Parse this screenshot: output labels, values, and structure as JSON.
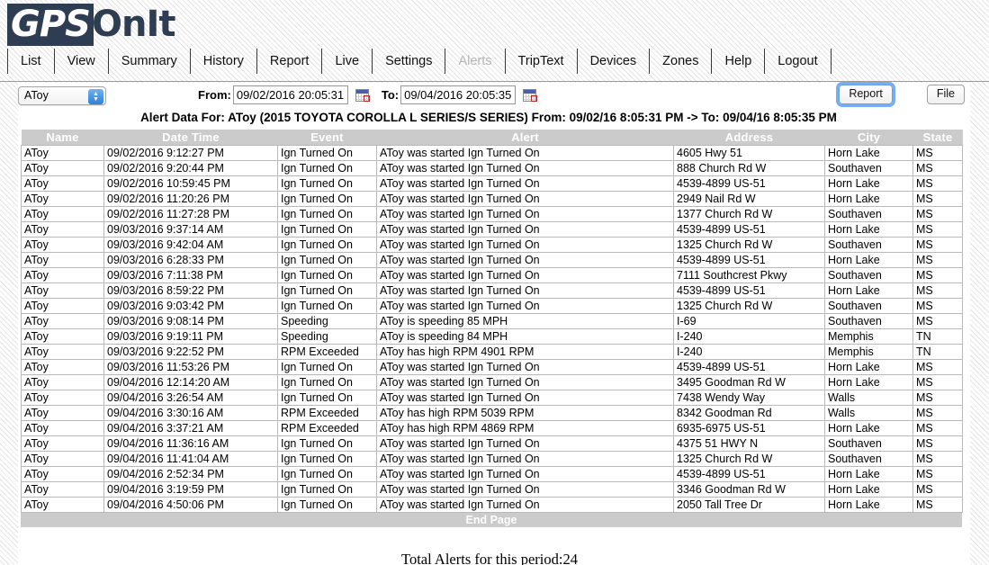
{
  "brand": {
    "logo_prefix": "GPS",
    "logo_suffix": "OnIt"
  },
  "nav": {
    "items": [
      {
        "label": "List",
        "active": false
      },
      {
        "label": "View",
        "active": false
      },
      {
        "label": "Summary",
        "active": false
      },
      {
        "label": "History",
        "active": false
      },
      {
        "label": "Report",
        "active": false
      },
      {
        "label": "Live",
        "active": false
      },
      {
        "label": "Settings",
        "active": false
      },
      {
        "label": "Alerts",
        "active": true
      },
      {
        "label": "TripText",
        "active": false
      },
      {
        "label": "Devices",
        "active": false
      },
      {
        "label": "Zones",
        "active": false
      },
      {
        "label": "Help",
        "active": false
      },
      {
        "label": "Logout",
        "active": false
      }
    ]
  },
  "toolbar": {
    "vehicle_select": {
      "selected": "AToy",
      "options": [
        "AToy"
      ]
    },
    "from_label": "From:",
    "from_value": "09/02/2016 20:05:31",
    "to_label": "To:",
    "to_value": "09/04/2016 20:05:35",
    "calendar_icon": "calendar-icon",
    "report_button": "Report",
    "file_button": "File"
  },
  "subtitle": "Alert Data For: AToy (2015 TOYOTA COROLLA L SERIES/S SERIES) From: 09/02/16 8:05:31 PM -> To: 09/04/16 8:05:35 PM",
  "table": {
    "columns": [
      "Name",
      "Date Time",
      "Event",
      "Alert",
      "Address",
      "City",
      "State"
    ],
    "rows": [
      [
        "AToy",
        "09/02/2016 9:12:27 PM",
        "Ign Turned On",
        "AToy was started Ign Turned On",
        "4605 Hwy 51",
        "Horn Lake",
        "MS"
      ],
      [
        "AToy",
        "09/02/2016 9:20:44 PM",
        "Ign Turned On",
        "AToy was started Ign Turned On",
        "888 Church Rd W",
        "Southaven",
        "MS"
      ],
      [
        "AToy",
        "09/02/2016 10:59:45 PM",
        "Ign Turned On",
        "AToy was started Ign Turned On",
        "4539-4899 US-51",
        "Horn Lake",
        "MS"
      ],
      [
        "AToy",
        "09/02/2016 11:20:26 PM",
        "Ign Turned On",
        "AToy was started Ign Turned On",
        "2949 Nail Rd W",
        "Horn Lake",
        "MS"
      ],
      [
        "AToy",
        "09/02/2016 11:27:28 PM",
        "Ign Turned On",
        "AToy was started Ign Turned On",
        "1377 Church Rd W",
        "Southaven",
        "MS"
      ],
      [
        "AToy",
        "09/03/2016 9:37:14 AM",
        "Ign Turned On",
        "AToy was started Ign Turned On",
        "4539-4899 US-51",
        "Horn Lake",
        "MS"
      ],
      [
        "AToy",
        "09/03/2016 9:42:04 AM",
        "Ign Turned On",
        "AToy was started Ign Turned On",
        "1325 Church Rd W",
        "Southaven",
        "MS"
      ],
      [
        "AToy",
        "09/03/2016 6:28:33 PM",
        "Ign Turned On",
        "AToy was started Ign Turned On",
        "4539-4899 US-51",
        "Horn Lake",
        "MS"
      ],
      [
        "AToy",
        "09/03/2016 7:11:38 PM",
        "Ign Turned On",
        "AToy was started Ign Turned On",
        "7111 Southcrest Pkwy",
        "Southaven",
        "MS"
      ],
      [
        "AToy",
        "09/03/2016 8:59:22 PM",
        "Ign Turned On",
        "AToy was started Ign Turned On",
        "4539-4899 US-51",
        "Horn Lake",
        "MS"
      ],
      [
        "AToy",
        "09/03/2016 9:03:42 PM",
        "Ign Turned On",
        "AToy was started Ign Turned On",
        "1325 Church Rd W",
        "Southaven",
        "MS"
      ],
      [
        "AToy",
        "09/03/2016 9:08:14 PM",
        "Speeding",
        "AToy is speeding 85 MPH",
        "I-69",
        "Southaven",
        "MS"
      ],
      [
        "AToy",
        "09/03/2016 9:19:11 PM",
        "Speeding",
        "AToy is speeding 84 MPH",
        "I-240",
        "Memphis",
        "TN"
      ],
      [
        "AToy",
        "09/03/2016 9:22:52 PM",
        "RPM Exceeded",
        "AToy has high RPM 4901 RPM",
        "I-240",
        "Memphis",
        "TN"
      ],
      [
        "AToy",
        "09/03/2016 11:53:26 PM",
        "Ign Turned On",
        "AToy was started Ign Turned On",
        "4539-4899 US-51",
        "Horn Lake",
        "MS"
      ],
      [
        "AToy",
        "09/04/2016 12:14:20 AM",
        "Ign Turned On",
        "AToy was started Ign Turned On",
        "3495 Goodman Rd W",
        "Horn Lake",
        "MS"
      ],
      [
        "AToy",
        "09/04/2016 3:26:54 AM",
        "Ign Turned On",
        "AToy was started Ign Turned On",
        "7438 Wendy Way",
        "Walls",
        "MS"
      ],
      [
        "AToy",
        "09/04/2016 3:30:16 AM",
        "RPM Exceeded",
        "AToy has high RPM 5039 RPM",
        "8342 Goodman Rd",
        "Walls",
        "MS"
      ],
      [
        "AToy",
        "09/04/2016 3:37:21 AM",
        "RPM Exceeded",
        "AToy has high RPM 4869 RPM",
        "6935-6975 US-51",
        "Horn Lake",
        "MS"
      ],
      [
        "AToy",
        "09/04/2016 11:36:16 AM",
        "Ign Turned On",
        "AToy was started Ign Turned On",
        "4375 51 HWY N",
        "Southaven",
        "MS"
      ],
      [
        "AToy",
        "09/04/2016 11:41:04 AM",
        "Ign Turned On",
        "AToy was started Ign Turned On",
        "1325 Church Rd W",
        "Southaven",
        "MS"
      ],
      [
        "AToy",
        "09/04/2016 2:52:34 PM",
        "Ign Turned On",
        "AToy was started Ign Turned On",
        "4539-4899 US-51",
        "Horn Lake",
        "MS"
      ],
      [
        "AToy",
        "09/04/2016 3:19:59 PM",
        "Ign Turned On",
        "AToy was started Ign Turned On",
        "3346 Goodman Rd W",
        "Horn Lake",
        "MS"
      ],
      [
        "AToy",
        "09/04/2016 4:50:06 PM",
        "Ign Turned On",
        "AToy was started Ign Turned On",
        "2050 Tall Tree Dr",
        "Horn Lake",
        "MS"
      ]
    ]
  },
  "footer": {
    "end_page": "End Page",
    "total": "Total Alerts for this period:24"
  },
  "colors": {
    "brand_navy": "#2e3d51",
    "header_grey": "#cbcbcb",
    "focus_blue": "#5da0f0"
  }
}
